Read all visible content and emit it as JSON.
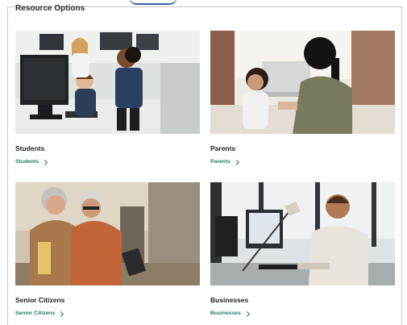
{
  "section": {
    "title": "Resource Options"
  },
  "cards": [
    {
      "title": "Students",
      "link": "Students",
      "photo_icon": "students-photo"
    },
    {
      "title": "Parents",
      "link": "Parents",
      "photo_icon": "parents-photo"
    },
    {
      "title": "Senior Citizens",
      "link": "Senior Citizens",
      "photo_icon": "seniors-photo"
    },
    {
      "title": "Businesses",
      "link": "Businesses",
      "photo_icon": "business-photo"
    }
  ],
  "colors": {
    "link": "#1e7a6b",
    "title": "#1f1f1f",
    "frame": "#c9c9c9"
  }
}
